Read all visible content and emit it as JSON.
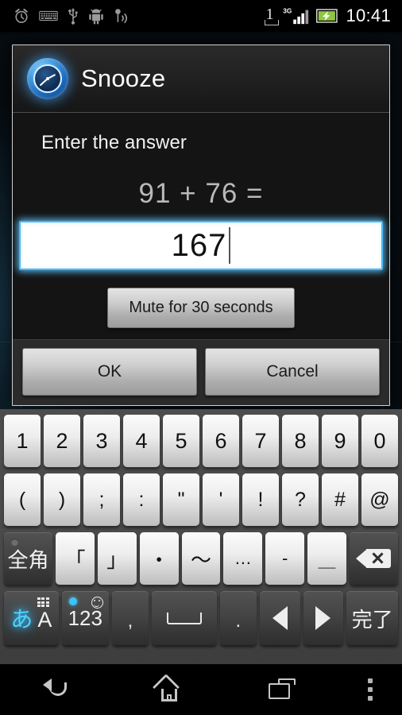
{
  "statusbar": {
    "icons_left": [
      "alarm-clock-icon",
      "keyboard-icon",
      "usb-icon",
      "android-robot-icon",
      "wifi-tether-icon"
    ],
    "sim_indicator": "1",
    "network_type": "3G",
    "battery": "charging",
    "time": "10:41"
  },
  "dialog": {
    "icon": "alarm-clock-icon",
    "title": "Snooze",
    "prompt": "Enter the answer",
    "question": "91 + 76 =",
    "answer_value": "167",
    "mute_button": "Mute for 30 seconds",
    "ok_button": "OK",
    "cancel_button": "Cancel"
  },
  "keyboard": {
    "row1": [
      "1",
      "2",
      "3",
      "4",
      "5",
      "6",
      "7",
      "8",
      "9",
      "0"
    ],
    "row2": [
      "(",
      ")",
      ";",
      ":",
      "\"",
      "'",
      "!",
      "?",
      "#",
      "@"
    ],
    "row3": [
      "全角",
      "「",
      "」",
      "・",
      "〜",
      "…",
      "-",
      "＿",
      "backspace-icon"
    ],
    "row4": [
      "あA",
      "123",
      ",",
      "space-icon",
      ".",
      "arrow-left-icon",
      "arrow-right-icon",
      "完了"
    ],
    "row4_labels": {
      "lang_hira": "あ",
      "lang_latin": "A",
      "numeric": "123",
      "comma": ",",
      "period": ".",
      "done": "完了"
    }
  },
  "navbar": {
    "back": "back-icon",
    "home": "home-icon",
    "recents": "recents-icon",
    "menu": "menu-icon"
  },
  "colors": {
    "accent": "#4fb8ef",
    "dialog_bg": "#141414",
    "key_light": "#ededed",
    "key_dark": "#444444"
  }
}
